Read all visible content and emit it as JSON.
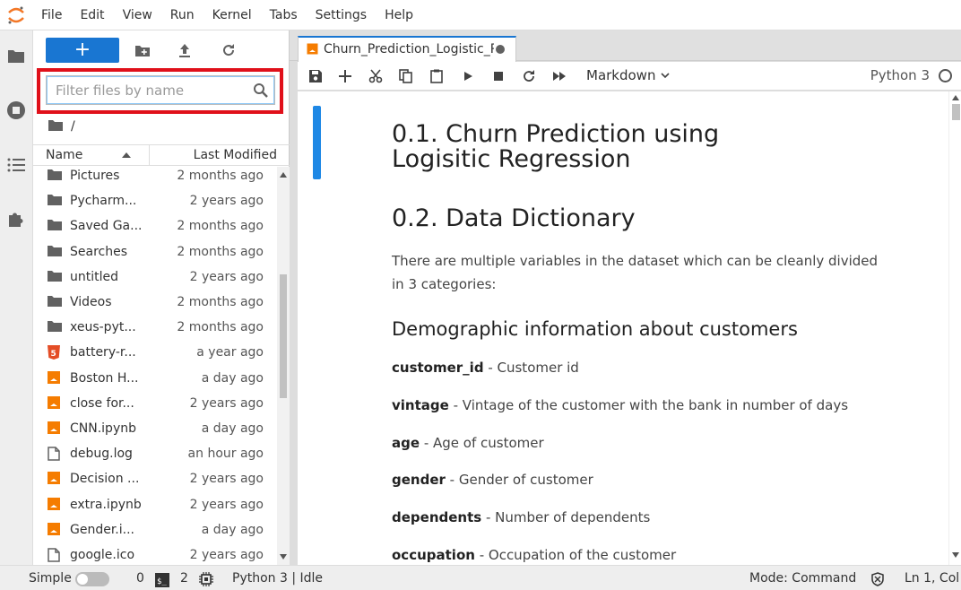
{
  "menu": [
    "File",
    "Edit",
    "View",
    "Run",
    "Kernel",
    "Tabs",
    "Settings",
    "Help"
  ],
  "filebrowser": {
    "new_label": "+",
    "filter_placeholder": "Filter files by name",
    "breadcrumb": "/",
    "col_name": "Name",
    "col_modified": "Last Modified",
    "files": [
      {
        "name": "Pictures",
        "modified": "2 months ago",
        "icon": "folder-icon"
      },
      {
        "name": "Pycharm...",
        "modified": "2 years ago",
        "icon": "folder-icon"
      },
      {
        "name": "Saved Ga...",
        "modified": "2 months ago",
        "icon": "folder-icon"
      },
      {
        "name": "Searches",
        "modified": "2 months ago",
        "icon": "folder-icon"
      },
      {
        "name": "untitled",
        "modified": "2 years ago",
        "icon": "folder-icon"
      },
      {
        "name": "Videos",
        "modified": "2 months ago",
        "icon": "folder-icon"
      },
      {
        "name": "xeus-pyt...",
        "modified": "2 months ago",
        "icon": "folder-icon"
      },
      {
        "name": "battery-r...",
        "modified": "a year ago",
        "icon": "html5-icon"
      },
      {
        "name": "Boston H...",
        "modified": "a day ago",
        "icon": "notebook-icon"
      },
      {
        "name": "close for...",
        "modified": "2 years ago",
        "icon": "notebook-icon"
      },
      {
        "name": "CNN.ipynb",
        "modified": "a day ago",
        "icon": "notebook-icon"
      },
      {
        "name": "debug.log",
        "modified": "an hour ago",
        "icon": "file-icon"
      },
      {
        "name": "Decision ...",
        "modified": "2 years ago",
        "icon": "notebook-icon"
      },
      {
        "name": "extra.ipynb",
        "modified": "2 years ago",
        "icon": "notebook-icon"
      },
      {
        "name": "Gender.i...",
        "modified": "a day ago",
        "icon": "notebook-icon"
      },
      {
        "name": "google.ico",
        "modified": "2 years ago",
        "icon": "file-icon"
      }
    ]
  },
  "notebook": {
    "tab_title": "Churn_Prediction_Logistic_Re",
    "cell_type": "Markdown",
    "kernel": "Python 3",
    "h1_title": "0.1. Churn Prediction using Logisitic Regression",
    "h2_dictionary": "0.2. Data Dictionary",
    "intro": "There are multiple variables in the dataset which can be cleanly divided in 3 categories:",
    "h3_demographic": "Demographic information about customers",
    "fields": [
      {
        "name": "customer_id",
        "desc": " - Customer id"
      },
      {
        "name": "vintage",
        "desc": " - Vintage of the customer with the bank in number of days"
      },
      {
        "name": "age",
        "desc": " - Age of customer"
      },
      {
        "name": "gender",
        "desc": " - Gender of customer"
      },
      {
        "name": "dependents",
        "desc": " - Number of dependents"
      },
      {
        "name": "occupation",
        "desc": " - Occupation of the customer"
      }
    ]
  },
  "statusbar": {
    "simple_label": "Simple",
    "terminals": "0",
    "kernels": "2",
    "kernel_status": "Python 3 | Idle",
    "mode": "Mode: Command",
    "position": "Ln 1, Col"
  },
  "colors": {
    "accent": "#1976d2",
    "highlight": "#e0101a",
    "notebook_orange": "#f57c00",
    "html_red": "#e44d26"
  }
}
